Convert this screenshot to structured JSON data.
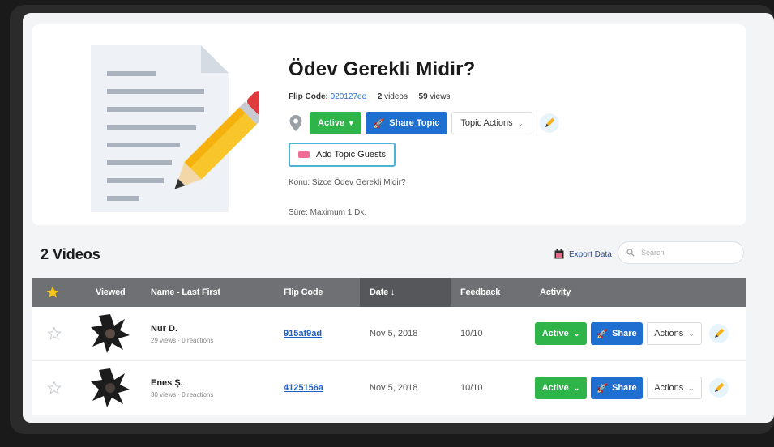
{
  "topic": {
    "title": "Ödev Gerekli Midir?",
    "flip_code_label": "Flip Code:",
    "flip_code": "020127ee",
    "videos_count": "2",
    "videos_label": "videos",
    "views_count": "59",
    "views_label": "views",
    "status_button": "Active",
    "share_button": "Share Topic",
    "actions_button": "Topic Actions",
    "guests_button": "Add Topic Guests",
    "description": "Konu: Sizce Ödev Gerekli Midir?",
    "duration": "Süre: Maximum 1 Dk."
  },
  "videos_section": {
    "title": "2 Videos",
    "export_label": "Export Data",
    "search_placeholder": "Search"
  },
  "table": {
    "headers": {
      "viewed": "Viewed",
      "name": "Name - Last First",
      "flip_code": "Flip Code",
      "date": "Date ↓",
      "feedback": "Feedback",
      "activity": "Activity"
    },
    "rows": [
      {
        "name": "Nur D.",
        "views": "29 views",
        "reactions": "0 reactions",
        "flip_code": "915af9ad",
        "date": "Nov 5, 2018",
        "feedback": "10/10",
        "status": "Active",
        "share": "Share",
        "actions": "Actions"
      },
      {
        "name": "Enes Ş.",
        "views": "30 views",
        "reactions": "0 reactions",
        "flip_code": "4125156a",
        "date": "Nov 5, 2018",
        "feedback": "10/10",
        "status": "Active",
        "share": "Share",
        "actions": "Actions"
      }
    ]
  },
  "icons": [
    "location-pin-icon",
    "chevron-down-icon",
    "rocket-icon",
    "pencil-icon",
    "ticket-icon",
    "calendar-icon",
    "search-icon",
    "star-icon"
  ],
  "colors": {
    "active_green": "#2fb44a",
    "share_blue": "#1f6fd1",
    "header_gray": "#6e7073",
    "star_gold": "#f5c518",
    "link_blue": "#1f5fc7"
  }
}
